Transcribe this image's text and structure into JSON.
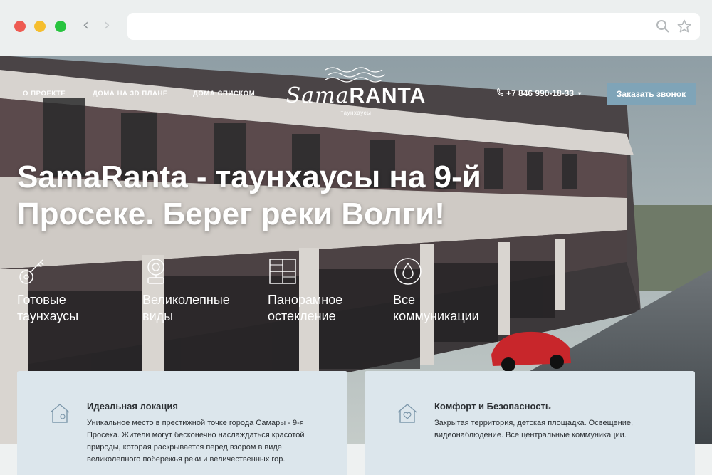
{
  "browser": {
    "url": "",
    "icons": [
      "back-arrow-icon",
      "forward-arrow-icon",
      "search-icon",
      "star-icon"
    ]
  },
  "nav": {
    "items": [
      "О проекте",
      "Дома на 3D плане",
      "Дома списком"
    ]
  },
  "logo": {
    "word_a": "Sama",
    "word_b": "RANTA",
    "subtitle": "таунхаусы"
  },
  "header": {
    "phone": "+7 846 990-18-33",
    "cta_label": "Заказать звонок"
  },
  "hero": {
    "title_line1": "SamaRanta - таунхаусы на 9-й",
    "title_line2": "Просеке. Берег реки Волги!"
  },
  "features": [
    {
      "line1": "Готовые",
      "line2": "таунхаусы",
      "icon": "key-icon"
    },
    {
      "line1": "Великолепные",
      "line2": "виды",
      "icon": "camera-icon"
    },
    {
      "line1": "Панорамное",
      "line2": "остекление",
      "icon": "window-icon"
    },
    {
      "line1": "Все",
      "line2": "коммуникации",
      "icon": "drop-icon"
    }
  ],
  "cards": [
    {
      "title": "Идеальная локация",
      "text": "Уникальное место в престижной точке города Самары - 9-я Просека. Жители могут бесконечно наслаждаться красотой природы, которая раскрывается перед взором в виде великолепного побережья реки и величественных гор.",
      "icon": "home-location-icon"
    },
    {
      "title": "Комфорт и Безопасность",
      "text": "Закрытая территория, детская площадка. Освещение, видеонаблюдение. Все центральные коммуникации.",
      "icon": "home-heart-icon"
    }
  ],
  "colors": {
    "cta": "#7fa4b8",
    "card_bg": "#dce6ec"
  }
}
